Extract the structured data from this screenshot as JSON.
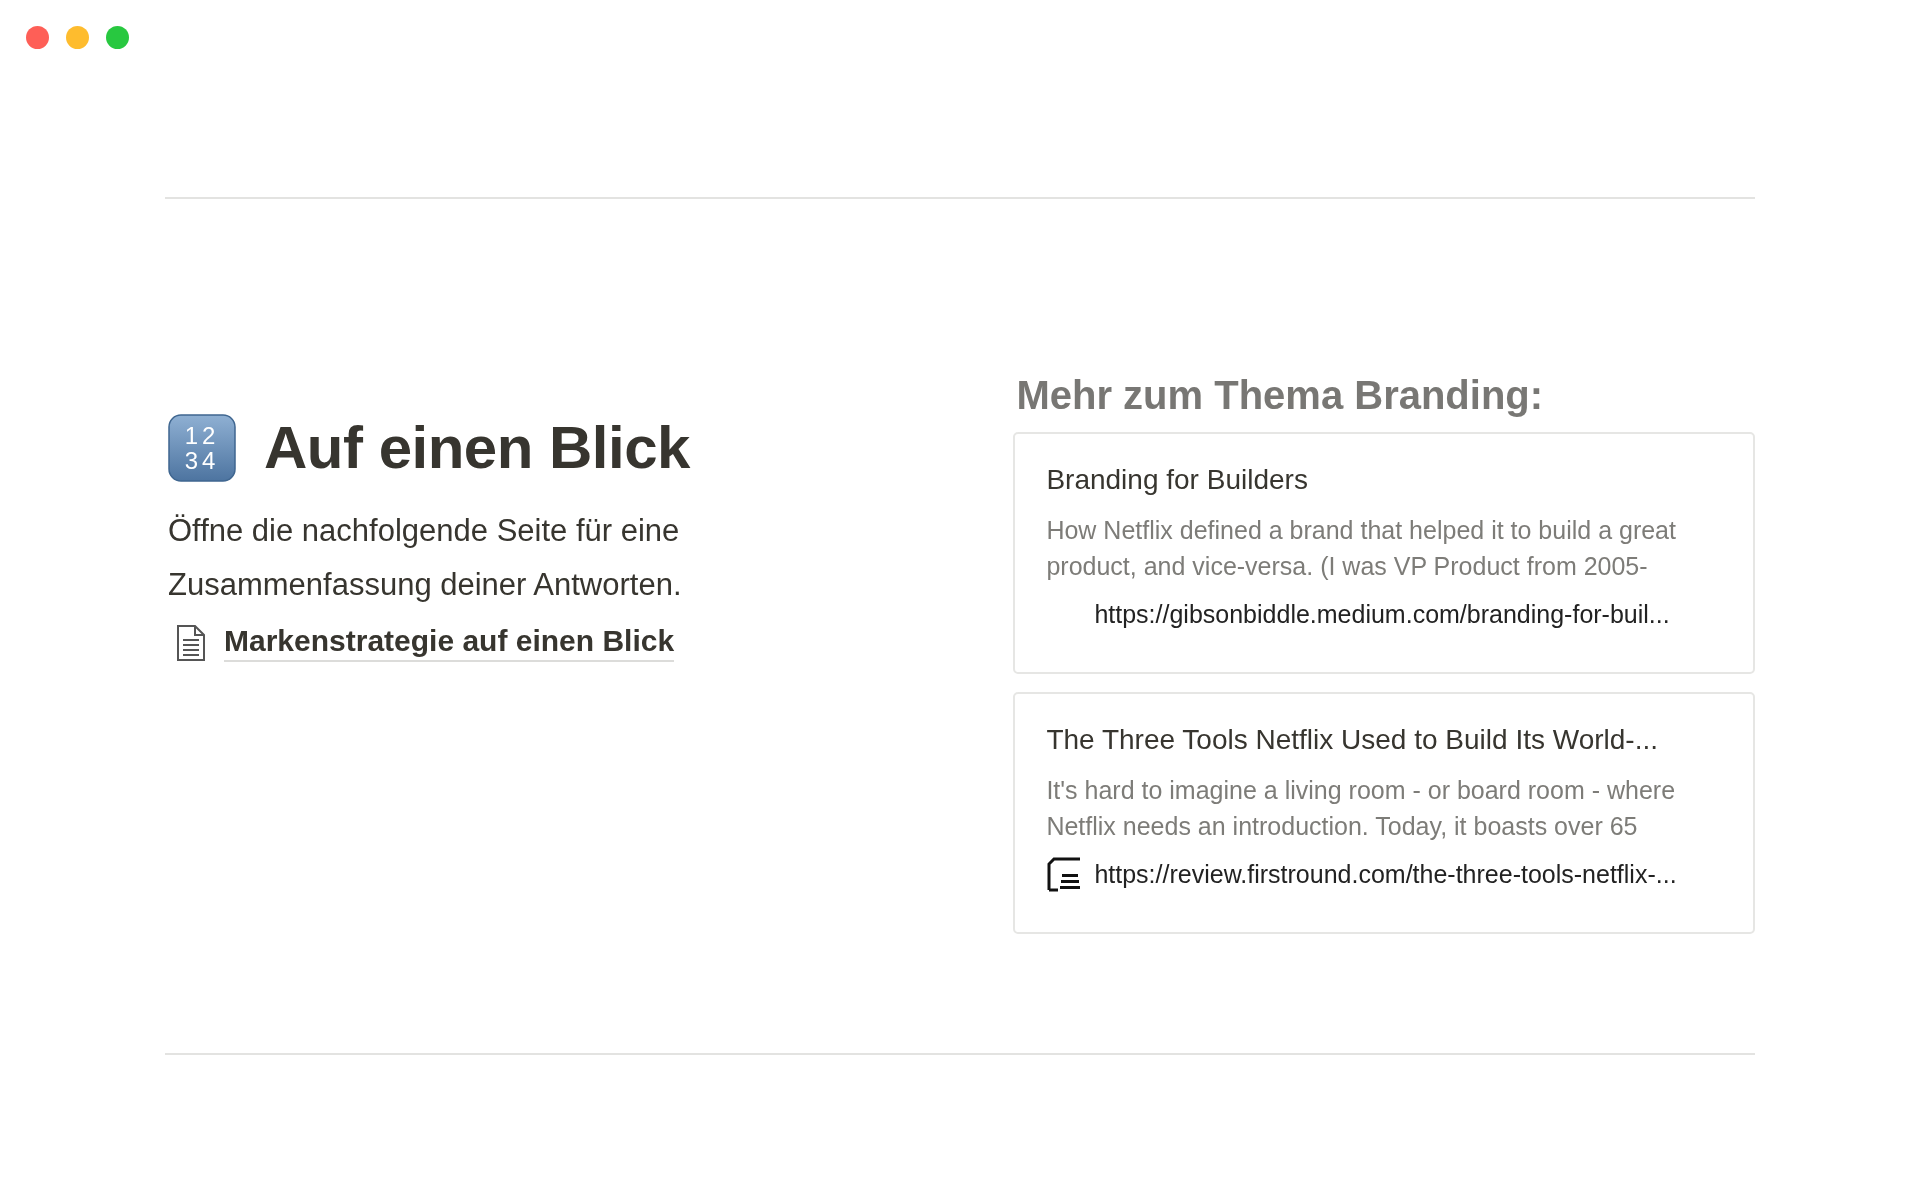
{
  "window": {
    "controls": [
      {
        "color": "#fe5f57"
      },
      {
        "color": "#febc2e"
      },
      {
        "color": "#28c840"
      }
    ]
  },
  "page": {
    "title_icon": {
      "rows": [
        "12",
        "34"
      ]
    },
    "title": "Auf einen Blick",
    "intro": "Öffne die nachfolgende Seite für eine Zusammenfassung deiner Antworten.",
    "page_link": "Markenstrategie auf einen Blick"
  },
  "related": {
    "heading": "Mehr zum Thema Branding:",
    "bookmarks": [
      {
        "title": "Branding for Builders",
        "description": "How Netflix defined a brand that helped it to build a great product, and vice-versa. (I was VP Product from 2005-",
        "url": "https://gibsonbiddle.medium.com/branding-for-buil...",
        "favicon": false
      },
      {
        "title": "The Three Tools Netflix Used to Build Its World-...",
        "description": "It's hard to imagine a living room - or board room - where Netflix needs an introduction. Today, it boasts over 65",
        "url": "https://review.firstround.com/the-three-tools-netflix-...",
        "favicon": true
      }
    ]
  }
}
